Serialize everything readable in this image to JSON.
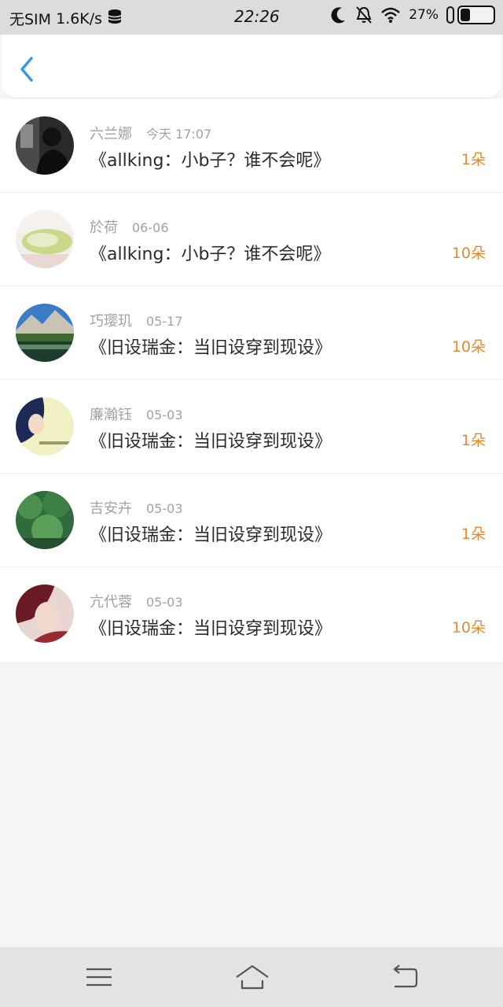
{
  "status_bar": {
    "carrier": "无SIM",
    "speed": "1.6K/s",
    "time": "22:26",
    "battery": "27%",
    "icons": [
      "database-icon",
      "moon-icon",
      "mute-bell-icon",
      "wifi-icon",
      "battery-icon"
    ]
  },
  "header": {
    "back_icon": "chevron-left-icon"
  },
  "colors": {
    "accent": "#2e9be8",
    "amount": "#e8872c",
    "meta": "#a2a2a2",
    "title": "#2a2a2a"
  },
  "items": [
    {
      "name": "六兰娜",
      "time": "今天 17:07",
      "title": "《allking：小b子？谁不会呢》",
      "amount": "1朵"
    },
    {
      "name": "於荷",
      "time": "06-06",
      "title": "《allking：小b子？谁不会呢》",
      "amount": "10朵"
    },
    {
      "name": "巧璎玑",
      "time": "05-17",
      "title": "《旧设瑞金：当旧设穿到现设》",
      "amount": "10朵"
    },
    {
      "name": "廉瀚钰",
      "time": "05-03",
      "title": "《旧设瑞金：当旧设穿到现设》",
      "amount": "1朵"
    },
    {
      "name": "吉安卉",
      "time": "05-03",
      "title": "《旧设瑞金：当旧设穿到现设》",
      "amount": "1朵"
    },
    {
      "name": "亢代蓉",
      "time": "05-03",
      "title": "《旧设瑞金：当旧设穿到现设》",
      "amount": "10朵"
    }
  ],
  "nav": {
    "icons": [
      "menu-icon",
      "home-icon",
      "back-icon"
    ]
  }
}
